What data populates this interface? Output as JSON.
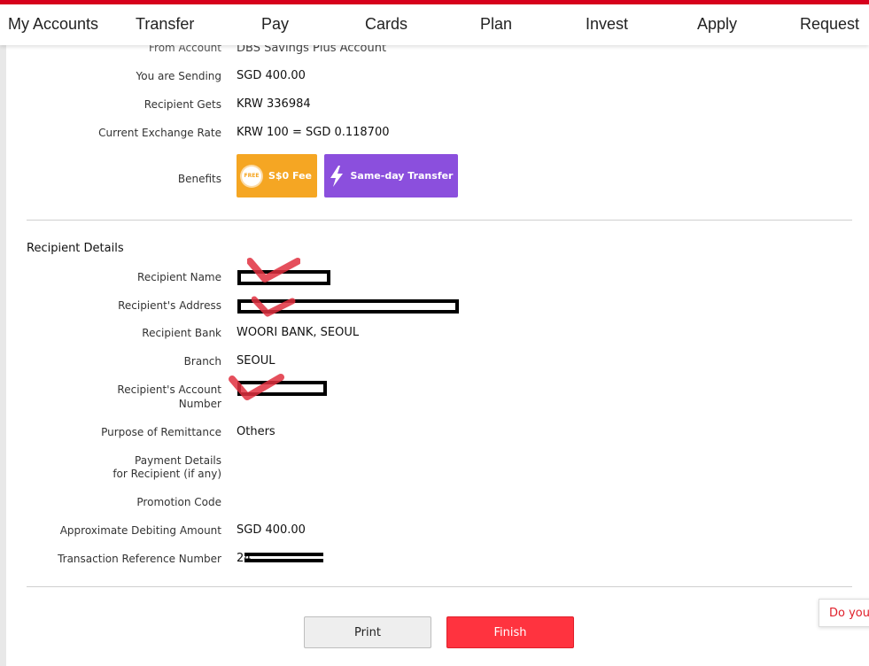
{
  "nav": {
    "items": [
      "My Accounts",
      "Transfer",
      "Pay",
      "Cards",
      "Plan",
      "Invest",
      "Apply",
      "Request"
    ]
  },
  "summary": {
    "from_account_label": "From Account",
    "from_account_value": "DBS Savings Plus Account",
    "sending_label": "You are Sending",
    "sending_value": "SGD  400.00",
    "gets_label": "Recipient Gets",
    "gets_value": "KRW 336984",
    "rate_label": "Current Exchange Rate",
    "rate_value": "KRW 100 = SGD 0.118700",
    "benefits_label": "Benefits",
    "benefit_fee": "S$0 Fee",
    "benefit_fee_seal": "FREE",
    "benefit_same_day": "Same-day Transfer"
  },
  "recipient": {
    "section_title": "Recipient Details",
    "name_label": "Recipient Name",
    "address_label": "Recipient's Address",
    "bank_label": "Recipient Bank",
    "bank_value": "WOORI BANK, SEOUL",
    "branch_label": "Branch",
    "branch_value": "SEOUL",
    "account_label_1": "Recipient's Account",
    "account_label_2": "Number",
    "purpose_label": "Purpose of Remittance",
    "purpose_value": "Others",
    "payment_details_label_1": "Payment Details",
    "payment_details_label_2": "for Recipient (if any)",
    "promo_label": "Promotion Code",
    "debit_label": "Approximate Debiting Amount",
    "debit_value": "SGD 400.00",
    "ref_label": "Transaction Reference Number",
    "ref_value_prefix": "24"
  },
  "actions": {
    "print": "Print",
    "finish": "Finish"
  },
  "help": {
    "label": "Do you"
  },
  "colors": {
    "brand_red": "#d7001c",
    "finish_red": "#ff333f",
    "fee_orange": "#f5a623",
    "same_day_purple": "#8b4fdd"
  }
}
